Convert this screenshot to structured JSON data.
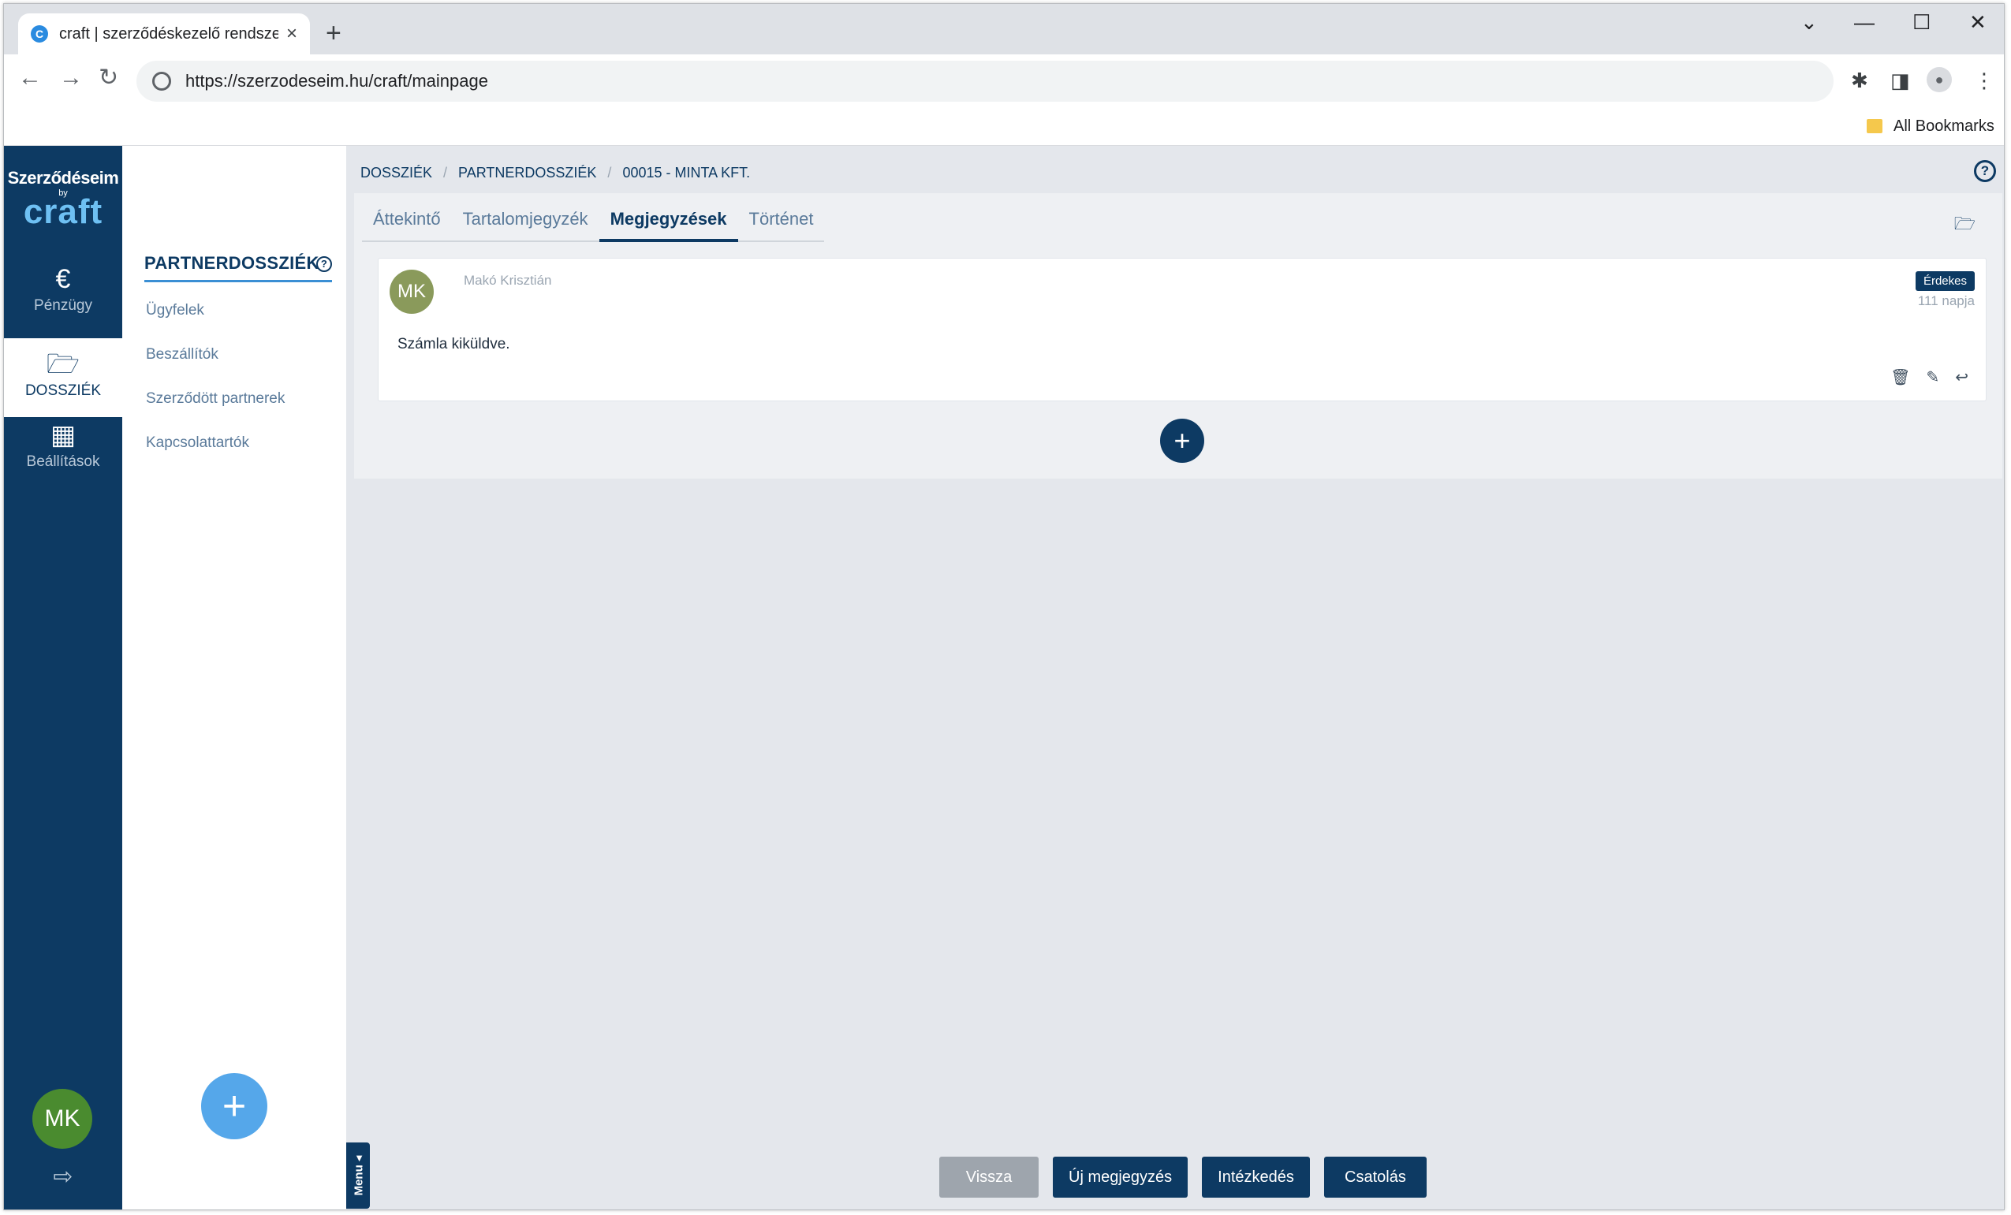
{
  "browser": {
    "tab_title": "craft | szerződéskezelő rendszer",
    "tab_favicon_letter": "C",
    "url": "https://szerzodeseim.hu/craft/mainpage",
    "bookmarks_label": "All Bookmarks",
    "icons": {
      "close": "×",
      "new_tab": "+",
      "back": "←",
      "forward": "→",
      "reload": "↻",
      "extensions": "✱",
      "sidebar": "◨",
      "profile": "●",
      "more": "⋮",
      "win_dropdown": "⌄",
      "win_minimize": "—",
      "win_maximize": "☐",
      "win_close": "✕"
    }
  },
  "brand": {
    "line1": "Szerződéseim",
    "line2": "by",
    "line3": "craft"
  },
  "rail": {
    "items": [
      {
        "icon": "€",
        "label": "Pénzügy"
      },
      {
        "icon": "🗁",
        "label": "DOSSZIÉK"
      },
      {
        "icon": "▦",
        "label": "Beállítások"
      }
    ],
    "user_initials": "MK",
    "logout_icon": "⇨"
  },
  "subnav": {
    "title": "PARTNERDOSSZIÉK",
    "help_icon": "?",
    "items": [
      "Ügyfelek",
      "Beszállítók",
      "Szerződött partnerek",
      "Kapcsolattartók"
    ],
    "add_icon": "+"
  },
  "breadcrumb": [
    "DOSSZIÉK",
    "PARTNERDOSSZIÉK",
    "00015 - MINTA KFT."
  ],
  "breadcrumb_sep": "/",
  "help_icon": "?",
  "tabs": [
    "Áttekintő",
    "Tartalomjegyzék",
    "Megjegyzések",
    "Történet"
  ],
  "active_tab": "Megjegyzések",
  "folder_icon": "🗁",
  "note": {
    "initials": "MK",
    "author": "Makó Krisztián",
    "badge": "Érdekes",
    "age": "111 napja",
    "text": "Számla kiküldve.",
    "actions": {
      "delete": "🗑",
      "edit": "✎",
      "reply": "↩"
    }
  },
  "add_note_icon": "+",
  "menu_tab_label": "Menu ◂",
  "bottom_buttons": {
    "back": "Vissza",
    "new_note": "Új megjegyzés",
    "action": "Intézkedés",
    "attach": "Csatolás"
  },
  "colors": {
    "primary": "#0d3a63",
    "accent": "#55a7ea",
    "avatar_green": "#4a8b2f",
    "note_avatar": "#8a9a5b",
    "disabled": "#9ea5ad"
  }
}
